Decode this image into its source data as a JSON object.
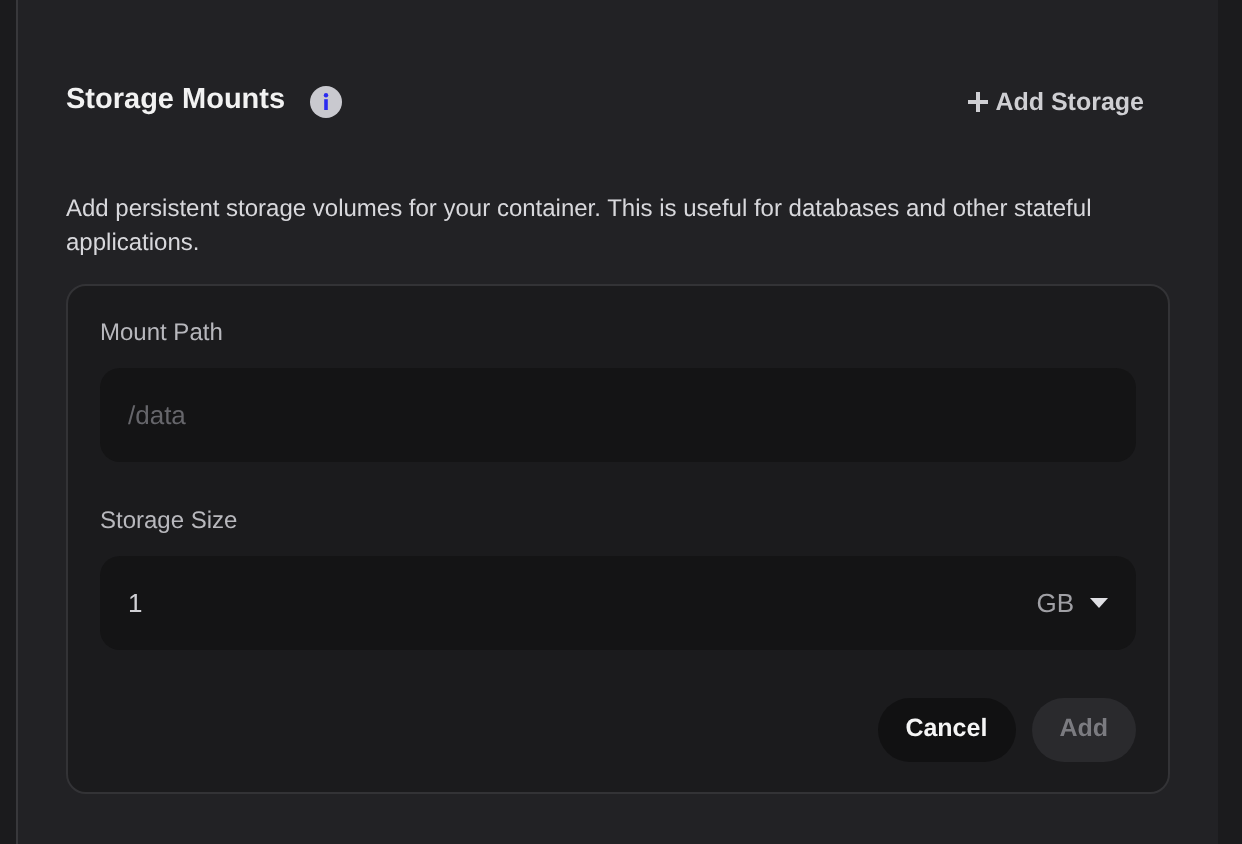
{
  "section": {
    "title": "Storage Mounts",
    "add_button": "Add Storage",
    "description": "Add persistent storage volumes for your container. This is useful for databases and other stateful applications."
  },
  "form": {
    "fields": [
      {
        "kind": "text",
        "label": "Mount Path",
        "placeholder": "/data"
      },
      {
        "kind": "size",
        "label": "Storage Size",
        "value": "1",
        "unit": "GB"
      }
    ],
    "buttons": [
      {
        "label": "Cancel",
        "disabled": false
      },
      {
        "label": "Add",
        "disabled": true
      }
    ]
  }
}
